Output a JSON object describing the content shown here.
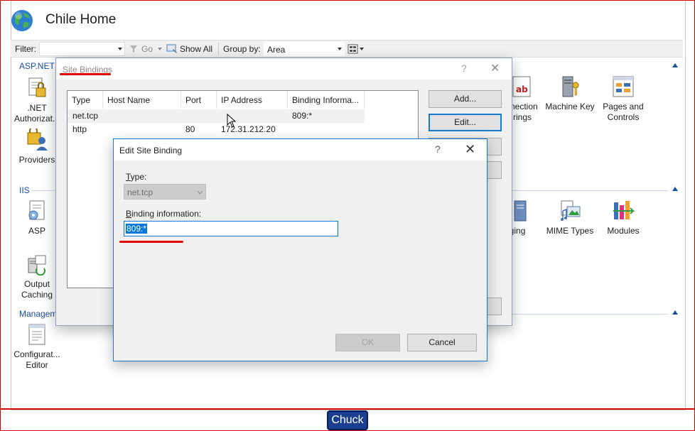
{
  "app": {
    "title": "Chile Home"
  },
  "filterbar": {
    "filter_label": "Filter:",
    "filter_value": "",
    "go_label": "Go",
    "show_all_label": "Show All",
    "group_by_label": "Group by:",
    "group_by_value": "Area"
  },
  "sections": {
    "aspnet": "ASP.NET",
    "iis": "IIS",
    "management": "Managem"
  },
  "features": {
    "net_authorization_1": ".NET",
    "net_authorization_2": "Authorizat...",
    "providers": "Providers",
    "asp": "ASP",
    "output_caching_1": "Output",
    "output_caching_2": "Caching",
    "config_editor_1": "Configurat...",
    "config_editor_2": "Editor",
    "connection_strings_1": "nection",
    "connection_strings_2": "rings",
    "machine_key": "Machine Key",
    "pages_controls_1": "Pages and",
    "pages_controls_2": "Controls",
    "logging": "gging",
    "mime_types": "MIME Types",
    "modules": "Modules"
  },
  "site_bindings": {
    "title": "Site Bindings",
    "help": "?",
    "close": "✕",
    "columns": [
      "Type",
      "Host Name",
      "Port",
      "IP Address",
      "Binding Informa..."
    ],
    "rows": [
      {
        "type": "net.tcp",
        "host": "",
        "port": "",
        "ip": "",
        "binding": "809:*"
      },
      {
        "type": "http",
        "host": "",
        "port": "80",
        "ip": "172.31.212.20",
        "binding": ""
      }
    ],
    "add_label": "Add...",
    "edit_label": "Edit..."
  },
  "edit_binding": {
    "title": "Edit Site Binding",
    "help": "?",
    "close": "✕",
    "type_label_mnemonic": "T",
    "type_label_rest": "ype:",
    "type_value": "net.tcp",
    "binding_label_mnemonic": "B",
    "binding_label_rest": "inding information:",
    "binding_value": "809:*",
    "ok_label": "OK",
    "cancel_label": "Cancel"
  },
  "taskbar": {
    "button_label": "Chuck"
  },
  "colors": {
    "accent": "#1a4ea0",
    "annotation_red": "#e00000",
    "focus_blue": "#0078d7"
  }
}
